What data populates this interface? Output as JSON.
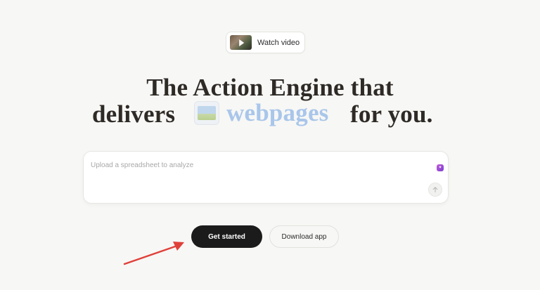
{
  "watch_video": {
    "label": "Watch video",
    "thumbnail_icon": "video-thumbnail-play-icon"
  },
  "headline": {
    "line1": "The Action Engine that",
    "line2_before": "delivers",
    "rotating_word": "webpages",
    "line2_after": "for you.",
    "rotating_icon": "image-icon",
    "rotating_color": "#a9c6ea"
  },
  "prompt": {
    "placeholder": "Upload a spreadsheet to analyze",
    "value": "",
    "plugin_icon": "app-plugin-icon",
    "send_icon": "arrow-up-icon"
  },
  "cta": {
    "primary_label": "Get started",
    "secondary_label": "Download app"
  },
  "annotation": {
    "type": "arrow",
    "color": "#e0403a",
    "points_to": "Get started"
  },
  "colors": {
    "background": "#f7f7f5",
    "primary_button": "#1b1b1b",
    "text": "#2e2a26"
  }
}
